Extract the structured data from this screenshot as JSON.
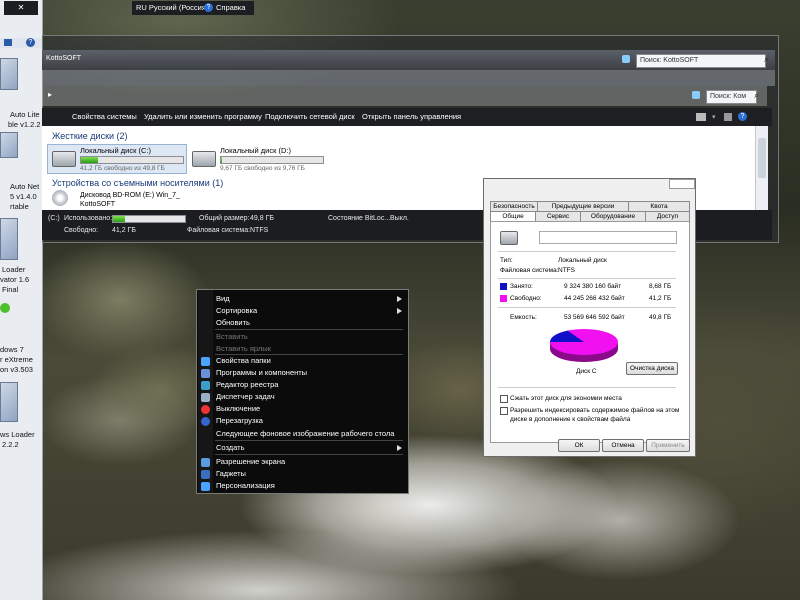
{
  "top_bar": {
    "language": "RU Русский (Россия)",
    "help": "Справка"
  },
  "left_pane": {
    "labels": [
      "Auto Lite",
      "ble v1.2.2",
      "Auto Net",
      "5 v1.4.0",
      "rtable",
      "Loader",
      "vator 1.6",
      "Final",
      "dows 7",
      "r eXtreme",
      "on v3.503",
      "ws Loader",
      "2.2.2"
    ]
  },
  "explorer": {
    "address_left": "KottoSOFT",
    "search1_placeholder": "Поиск: KottoSOFT",
    "search2_placeholder": "Поиск: Ком",
    "toolbar": [
      "Свойства системы",
      "Удалить или изменить программу",
      "Подключить сетевой диск",
      "Открыть панель управления"
    ],
    "hdd_group": "Жесткие диски (2)",
    "drives": [
      {
        "name": "Локальный диск (C:)",
        "free": "41,2 ГБ свободно из 49,8 ГБ",
        "used_fraction": 0.17
      },
      {
        "name": "Локальный диск (D:)",
        "free": "9,67 ГБ свободно из 9,76 ГБ",
        "used_fraction": 0.01
      }
    ],
    "removable_group": "Устройства со съемными носителями (1)",
    "dvd": {
      "name": "Дисковод BD-ROM (E:) Win_7_",
      "sub": "KottoSOFT"
    },
    "details": {
      "drive": "(C:)",
      "used_label": "Использовано:",
      "free_label": "Свободно:",
      "free_value": "41,2 ГБ",
      "total_label": "Общий размер:",
      "total_value": "49,8 ГБ",
      "fs_label": "Файловая система:",
      "fs_value": "NTFS",
      "bitlocker_label": "Состояние BitLoc...",
      "bitlocker_value": "Выкл.",
      "used_fraction": 0.17
    }
  },
  "properties": {
    "tabs_row1": [
      "Безопасность",
      "Предыдущие версии",
      "Квота"
    ],
    "tabs_row2": [
      "Общие",
      "Сервис",
      "Оборудование",
      "Доступ"
    ],
    "type_label": "Тип:",
    "type_value": "Локальный диск",
    "fs_label": "Файловая система:",
    "fs_value": "NTFS",
    "used_label": "Занято:",
    "used_bytes": "9 324 380 160 байт",
    "used_gb": "8,68 ГБ",
    "free_label": "Свободно:",
    "free_bytes": "44 245 266 432 байт",
    "free_gb": "41,2 ГБ",
    "capacity_label": "Емкость:",
    "capacity_bytes": "53 569 646 592 байт",
    "capacity_gb": "49,8 ГБ",
    "disk_label": "Диск C",
    "cleanup_button": "Очистка диска",
    "compress_checkbox": "Сжать этот диск для экономии места",
    "index_checkbox_line1": "Разрешить индексировать содержимое файлов на этом",
    "index_checkbox_line2": "диске в дополнение к свойствам файла",
    "ok": "ОК",
    "cancel": "Отмена",
    "apply": "Применить",
    "used_color": "#1010c8",
    "free_color": "#f010f0"
  },
  "context_menu": {
    "items": [
      {
        "label": "Вид",
        "arrow": true
      },
      {
        "label": "Сортировка",
        "arrow": true
      },
      {
        "label": "Обновить"
      },
      {
        "label": "Вставить",
        "disabled": true
      },
      {
        "label": "Вставить ярлык",
        "disabled": true
      },
      {
        "label": "Свойства папки"
      },
      {
        "label": "Программы и компоненты"
      },
      {
        "label": "Редактор реестра"
      },
      {
        "label": "Диспетчер задач"
      },
      {
        "label": "Выключение"
      },
      {
        "label": "Перезагрузка"
      },
      {
        "label": "Следующее фоновое изображение рабочего стола"
      },
      {
        "label": "Создать",
        "arrow": true
      },
      {
        "label": "Разрешение экрана"
      },
      {
        "label": "Гаджеты"
      },
      {
        "label": "Персонализация"
      }
    ]
  }
}
